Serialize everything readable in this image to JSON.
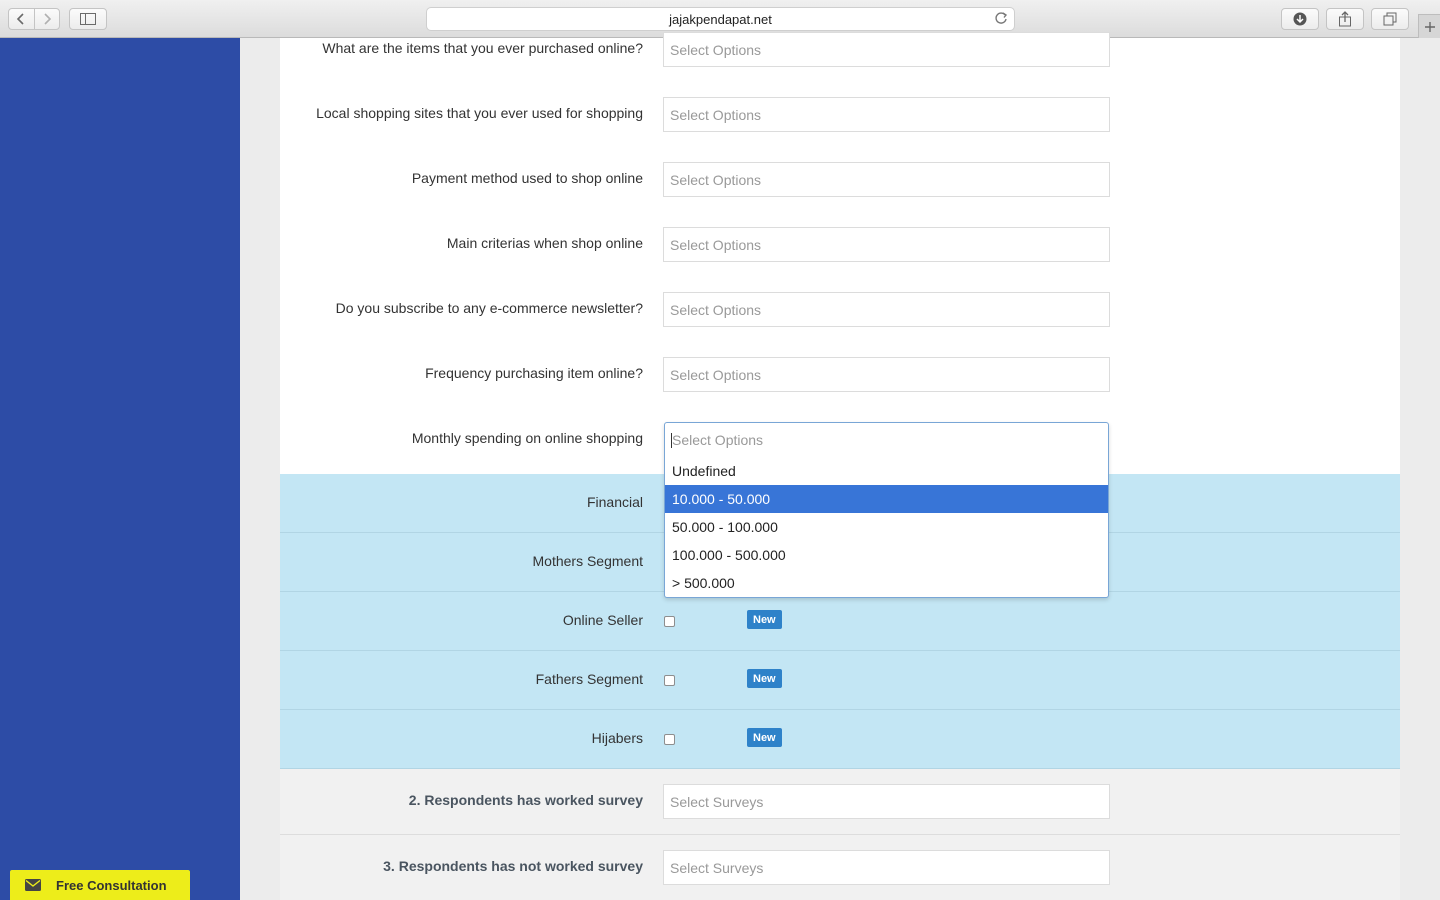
{
  "browser": {
    "url": "jajakpendapat.net"
  },
  "form": {
    "questions": [
      {
        "label": "What are the items that you ever purchased online?",
        "placeholder": "Select Options"
      },
      {
        "label": "Local shopping sites that you ever used for shopping",
        "placeholder": "Select Options"
      },
      {
        "label": "Payment method used to shop online",
        "placeholder": "Select Options"
      },
      {
        "label": "Main criterias when shop online",
        "placeholder": "Select Options"
      },
      {
        "label": "Do you subscribe to any e-commerce newsletter?",
        "placeholder": "Select Options"
      },
      {
        "label": "Frequency purchasing item online?",
        "placeholder": "Select Options"
      },
      {
        "label": "Monthly spending on online shopping",
        "placeholder": "Select Options"
      }
    ],
    "segments": [
      {
        "label": "Financial",
        "badge": ""
      },
      {
        "label": "Mothers Segment",
        "badge": ""
      },
      {
        "label": "Online Seller",
        "badge": "New"
      },
      {
        "label": "Fathers Segment",
        "badge": "New"
      },
      {
        "label": "Hijabers",
        "badge": "New"
      }
    ],
    "surveys": [
      {
        "label": "2. Respondents has worked survey",
        "placeholder": "Select Surveys"
      },
      {
        "label": "3. Respondents has not worked survey",
        "placeholder": "Select Surveys"
      }
    ]
  },
  "dropdown": {
    "placeholder": "Select Options",
    "options": [
      "Undefined",
      "10.000 - 50.000",
      "50.000 - 100.000",
      "100.000 - 500.000",
      "> 500.000"
    ],
    "highlighted": "10.000 - 50.000"
  },
  "consultation": {
    "label": "Free Consultation"
  },
  "colors": {
    "sidebar": "#2d4ca6",
    "segment_row": "#c3e6f4",
    "badge": "#2e82c9",
    "highlight": "#3875d7",
    "consult": "#eded1a"
  }
}
